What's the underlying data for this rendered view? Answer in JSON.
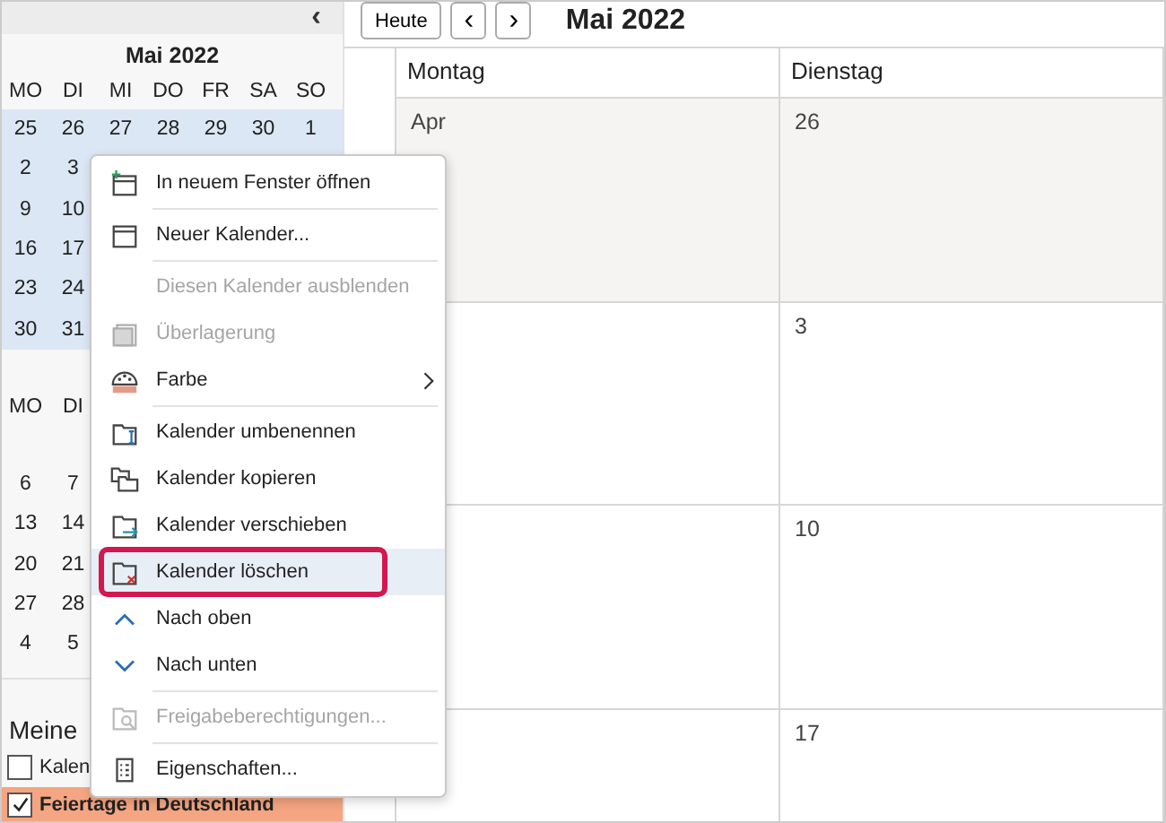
{
  "sidebar": {
    "collapse_label": "‹",
    "mini_calendar": {
      "title": "Mai 2022",
      "weekdays": [
        "MO",
        "DI",
        "MI",
        "DO",
        "FR",
        "SA",
        "SO"
      ],
      "weeks": [
        {
          "days": [
            "25",
            "26",
            "27",
            "28",
            "29",
            "30",
            "1"
          ],
          "selected": true
        },
        {
          "days": [
            "2",
            "3"
          ],
          "selected": true
        },
        {
          "days": [
            "9",
            "10"
          ],
          "selected": true
        },
        {
          "days": [
            "16",
            "17"
          ],
          "selected": true
        },
        {
          "days": [
            "23",
            "24"
          ],
          "selected": true
        },
        {
          "days": [
            "30",
            "31"
          ],
          "selected": true
        }
      ]
    },
    "mini_calendar_2": {
      "weekdays": [
        "MO",
        "DI"
      ],
      "weeks": [
        {
          "days": [
            "6",
            "7"
          ],
          "selected": false
        },
        {
          "days": [
            "13",
            "14"
          ],
          "selected": false
        },
        {
          "days": [
            "20",
            "21"
          ],
          "selected": false
        },
        {
          "days": [
            "27",
            "28"
          ],
          "selected": false
        },
        {
          "days": [
            "4",
            "5"
          ],
          "selected": false
        }
      ]
    },
    "group_title": "Meine",
    "calendars": [
      {
        "label": "Kalen",
        "checked": false,
        "selected": false
      },
      {
        "label": "Feiertage in Deutschland",
        "checked": true,
        "selected": true,
        "color": "#f4a582"
      }
    ]
  },
  "toolbar": {
    "today_button": "Heute",
    "prev_label": "‹",
    "next_label": "›",
    "title": "Mai 2022"
  },
  "month_view": {
    "columns": [
      "Montag",
      "Dienstag"
    ],
    "weeks": [
      {
        "cells": [
          "Apr",
          "26"
        ],
        "other_month": true
      },
      {
        "cells": [
          "",
          "3"
        ],
        "other_month": false
      },
      {
        "cells": [
          "",
          "10"
        ],
        "other_month": false
      },
      {
        "cells": [
          "",
          "17"
        ],
        "other_month": false
      }
    ]
  },
  "context_menu": {
    "items": [
      {
        "kind": "item",
        "label": "In neuem Fenster öffnen",
        "disabled": false,
        "selected": false
      },
      {
        "kind": "separator"
      },
      {
        "kind": "item",
        "label": "Neuer Kalender...",
        "disabled": false,
        "selected": false
      },
      {
        "kind": "separator"
      },
      {
        "kind": "item",
        "label": "Diesen Kalender ausblenden",
        "disabled": true,
        "selected": false
      },
      {
        "kind": "item",
        "label": "Überlagerung",
        "disabled": true,
        "selected": false
      },
      {
        "kind": "submenu",
        "label": "Farbe",
        "disabled": false,
        "selected": false
      },
      {
        "kind": "separator"
      },
      {
        "kind": "item",
        "label": "Kalender umbenennen",
        "disabled": false,
        "selected": false
      },
      {
        "kind": "item",
        "label": "Kalender kopieren",
        "disabled": false,
        "selected": false
      },
      {
        "kind": "item",
        "label": "Kalender verschieben",
        "disabled": false,
        "selected": false
      },
      {
        "kind": "item",
        "label": "Kalender löschen",
        "disabled": false,
        "selected": true,
        "highlighted": true
      },
      {
        "kind": "item",
        "label": "Nach oben",
        "disabled": false,
        "selected": false
      },
      {
        "kind": "item",
        "label": "Nach unten",
        "disabled": false,
        "selected": false
      },
      {
        "kind": "separator"
      },
      {
        "kind": "item",
        "label": "Freigabeberechtigungen...",
        "disabled": true,
        "selected": false
      },
      {
        "kind": "separator"
      },
      {
        "kind": "item",
        "label": "Eigenschaften...",
        "disabled": false,
        "selected": false
      }
    ]
  }
}
